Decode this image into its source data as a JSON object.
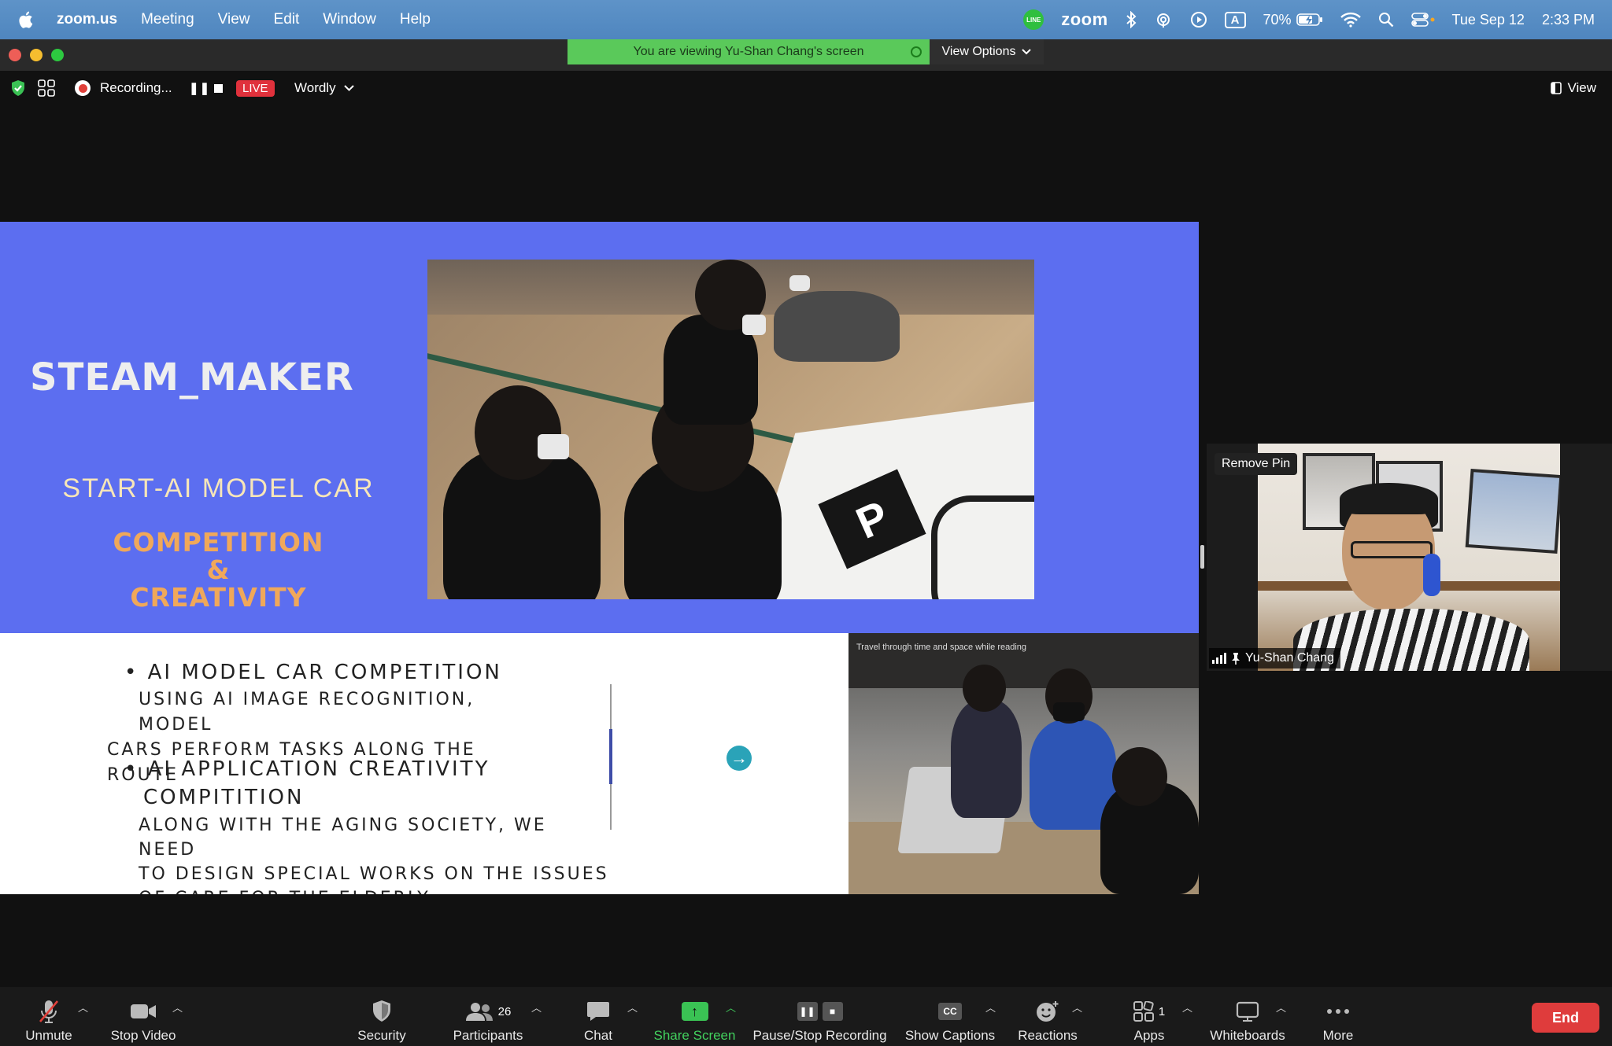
{
  "menubar": {
    "app_name": "zoom.us",
    "items": [
      "Meeting",
      "View",
      "Edit",
      "Window",
      "Help"
    ],
    "status": {
      "line_badge": "LINE",
      "zoom_label": "zoom",
      "input_source": "A",
      "battery": "70%",
      "date": "Tue Sep 12",
      "time": "2:33 PM"
    }
  },
  "banner": {
    "viewing_text": "You are viewing Yu-Shan Chang's screen",
    "view_options": "View Options"
  },
  "top_toolbar": {
    "recording_label": "Recording...",
    "live_label": "LIVE",
    "wordly_label": "Wordly",
    "view_label": "View"
  },
  "slide": {
    "title": "STEAM_MAKER",
    "subtitle": "START-AI MODEL CAR",
    "comp_line1": "COMPETITION",
    "comp_line2": "&",
    "comp_line3": "CREATIVITY",
    "sign_letter": "P",
    "bullet1": "• AI  MODEL CAR COMPETITION",
    "bullet1_sub_line1": "USING AI IMAGE RECOGNITION, MODEL",
    "bullet1_sub_line2": "CARS PERFORM TASKS ALONG THE ROUTE",
    "bullet2_line1": "• AI  APPLICATION CREATIVITY",
    "bullet2_line2": "COMPITITION",
    "bullet2_sub_line1": "ALONG WITH THE AGING SOCIETY, WE NEED",
    "bullet2_sub_line2": "TO DESIGN SPECIAL WORKS ON THE ISSUES",
    "bullet2_sub_line3": "OF CARE FOR THE ELDERLY",
    "photo_banner_text": "Travel through time and space while reading"
  },
  "participant": {
    "name": "Yu-Shan Chang",
    "remove_pin": "Remove Pin"
  },
  "bottom_toolbar": {
    "unmute": "Unmute",
    "stop_video": "Stop Video",
    "security": "Security",
    "participants": "Participants",
    "participants_count": "26",
    "chat": "Chat",
    "share_screen": "Share Screen",
    "recording": "Pause/Stop Recording",
    "captions": "Show Captions",
    "captions_icon": "CC",
    "reactions": "Reactions",
    "apps": "Apps",
    "apps_count": "1",
    "whiteboards": "Whiteboards",
    "more": "More",
    "end": "End"
  },
  "colors": {
    "slide_blue": "#5c6ef0",
    "share_green": "#3ac254",
    "end_red": "#df3c3c",
    "live_red": "#e0313c"
  }
}
